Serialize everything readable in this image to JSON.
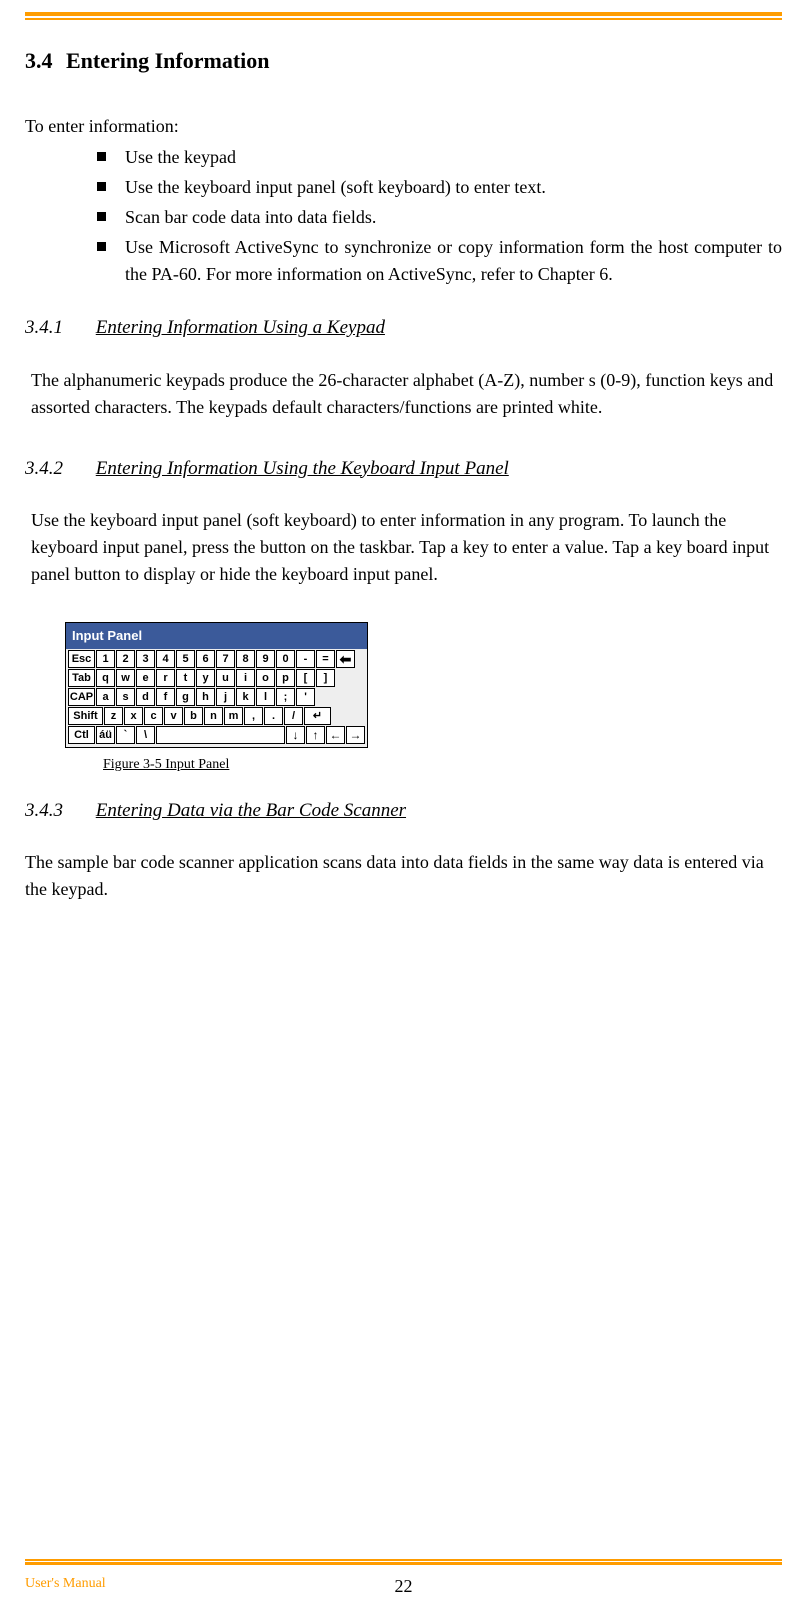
{
  "header": {
    "section_number": "3.4",
    "section_title": "Entering Information"
  },
  "intro": "To enter information:",
  "bullets": [
    "Use the keypad",
    "Use the keyboard input panel (soft keyboard) to enter text.",
    "Scan bar code data into data fields.",
    "Use Microsoft ActiveSync to synchronize or copy information form the host computer to the PA-60. For more information on ActiveSync, refer to Chapter 6."
  ],
  "s341": {
    "num": "3.4.1",
    "title": "Entering Information Using a Keypad",
    "body": "The alphanumeric keypads produce the 26-character alphabet (A-Z), number s (0-9), function keys and assorted characters. The keypads default characters/functions are printed white."
  },
  "s342": {
    "num": "3.4.2",
    "title": "Entering Information Using the Keyboard Input Panel",
    "body": "Use the keyboard input panel (soft keyboard) to enter information in any program. To launch the keyboard input panel, press the button on the taskbar. Tap a key to enter a value. Tap a key board input panel button to display or hide the keyboard input panel."
  },
  "input_panel": {
    "window_title": "Input Panel",
    "rows": {
      "r1": [
        "Esc",
        "1",
        "2",
        "3",
        "4",
        "5",
        "6",
        "7",
        "8",
        "9",
        "0",
        "-",
        "="
      ],
      "r2": [
        "Tab",
        "q",
        "w",
        "e",
        "r",
        "t",
        "y",
        "u",
        "i",
        "o",
        "p",
        "[",
        "]"
      ],
      "r3": [
        "CAP",
        "a",
        "s",
        "d",
        "f",
        "g",
        "h",
        "j",
        "k",
        "l",
        ";",
        "'"
      ],
      "r4": [
        "Shift",
        "z",
        "x",
        "c",
        "v",
        "b",
        "n",
        "m",
        ",",
        ".",
        "/"
      ],
      "r5": [
        "Ctl",
        "áü",
        "`",
        "\\"
      ]
    },
    "arrows": [
      "↓",
      "↑",
      "←",
      "→"
    ],
    "backspace": "⬅",
    "enter": "↵",
    "caption": "Figure 3-5 Input Panel"
  },
  "s343": {
    "num": "3.4.3",
    "title": "Entering Data via the Bar Code Scanner",
    "body": "The sample bar code scanner application scans data into data fields in the same way data is entered via the keypad."
  },
  "footer": {
    "left": "User's Manual",
    "page": "22"
  }
}
